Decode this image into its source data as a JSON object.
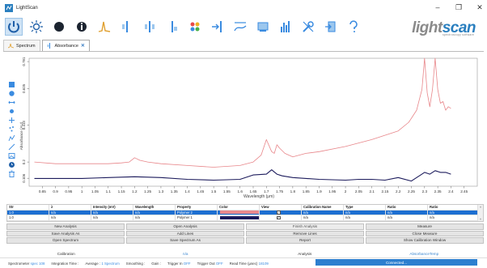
{
  "window": {
    "title": "LightScan"
  },
  "logo": {
    "part1": "light",
    "part2": "scan",
    "tagline": "spectroscopy software"
  },
  "tabs": [
    {
      "label": "Spectrum"
    },
    {
      "label": "Absorbance",
      "close": "✕"
    }
  ],
  "chart_data": {
    "type": "line",
    "xlabel": "Wavelength (μm)",
    "ylabel": "Absorbance (AU)",
    "xlim": [
      0.8,
      2.5
    ],
    "ylim": [
      0.06,
      0.8
    ],
    "x_ticks": [
      "0.85",
      "0.9",
      "0.95",
      "1",
      "1.05",
      "1.1",
      "1.15",
      "1.2",
      "1.25",
      "1.3",
      "1.35",
      "1.4",
      "1.45",
      "1.5",
      "1.55",
      "1.6",
      "1.65",
      "1.7",
      "1.75",
      "1.8",
      "1.85",
      "1.9",
      "1.95",
      "2",
      "2.05",
      "2.1",
      "2.15",
      "2.2",
      "2.25",
      "2.3",
      "2.35",
      "2.4",
      "2.45"
    ],
    "x_tick_values": [
      0.85,
      0.9,
      0.95,
      1,
      1.05,
      1.1,
      1.15,
      1.2,
      1.25,
      1.3,
      1.35,
      1.4,
      1.45,
      1.5,
      1.55,
      1.6,
      1.65,
      1.7,
      1.75,
      1.8,
      1.85,
      1.9,
      1.95,
      2,
      2.05,
      2.1,
      2.15,
      2.2,
      2.25,
      2.3,
      2.35,
      2.4,
      2.45
    ],
    "y_ticks": [
      "0.106",
      "0.2",
      "0.413",
      "0.625",
      "0.781"
    ],
    "y_tick_values": [
      0.106,
      0.2,
      0.413,
      0.625,
      0.781
    ],
    "series": [
      {
        "name": "Polymer 2",
        "color": "#e8868a",
        "x": [
          0.82,
          0.9,
          1.0,
          1.1,
          1.15,
          1.18,
          1.2,
          1.22,
          1.25,
          1.3,
          1.4,
          1.5,
          1.6,
          1.65,
          1.68,
          1.7,
          1.72,
          1.73,
          1.74,
          1.75,
          1.77,
          1.8,
          1.85,
          1.9,
          2.0,
          2.1,
          2.2,
          2.24,
          2.27,
          2.29,
          2.3,
          2.31,
          2.32,
          2.33,
          2.34,
          2.35,
          2.36,
          2.37,
          2.38,
          2.39,
          2.4
        ],
        "y": [
          0.2,
          0.19,
          0.19,
          0.19,
          0.195,
          0.2,
          0.225,
          0.21,
          0.2,
          0.19,
          0.18,
          0.17,
          0.18,
          0.2,
          0.24,
          0.33,
          0.26,
          0.25,
          0.3,
          0.28,
          0.25,
          0.23,
          0.25,
          0.26,
          0.29,
          0.33,
          0.38,
          0.43,
          0.5,
          0.62,
          0.8,
          0.6,
          0.52,
          0.62,
          0.8,
          0.62,
          0.54,
          0.55,
          0.5,
          0.52,
          0.51
        ]
      },
      {
        "name": "Polymer 1",
        "color": "#1c1b5c",
        "x": [
          0.82,
          0.9,
          1.0,
          1.1,
          1.2,
          1.3,
          1.4,
          1.5,
          1.6,
          1.65,
          1.7,
          1.72,
          1.74,
          1.76,
          1.8,
          1.9,
          2.0,
          2.05,
          2.1,
          2.15,
          2.2,
          2.25,
          2.28,
          2.3,
          2.32,
          2.34,
          2.36,
          2.38,
          2.4
        ],
        "y": [
          0.105,
          0.105,
          0.105,
          0.11,
          0.115,
          0.11,
          0.1,
          0.095,
          0.1,
          0.125,
          0.13,
          0.155,
          0.13,
          0.12,
          0.11,
          0.1,
          0.095,
          0.1,
          0.1,
          0.095,
          0.11,
          0.09,
          0.12,
          0.14,
          0.13,
          0.15,
          0.14,
          0.14,
          0.13
        ]
      }
    ]
  },
  "table": {
    "headers": [
      "Str",
      "λ",
      "Intensity (mV)",
      "Wavelength",
      "Property",
      "Color",
      "View",
      "Calibration Name",
      "Type",
      "Ratio",
      "Ratio"
    ],
    "rows": [
      {
        "str": "1.0",
        "lambda": "n/a",
        "intensity": "n/a",
        "wavelength": "n/a",
        "property": "Polymer 2",
        "color": "#e8888c",
        "view": "✓",
        "cal": "n/a",
        "type": "n/a",
        "ratio": "n/a",
        "ratio2": "n/a"
      },
      {
        "str": "1.0",
        "lambda": "n/a",
        "intensity": "n/a",
        "wavelength": "n/a",
        "property": "Polymer 1",
        "color": "#1c1b5c",
        "view": "✓",
        "cal": "n/a",
        "type": "n/a",
        "ratio": "n/a",
        "ratio2": "n/a"
      }
    ]
  },
  "buttons": {
    "new_analysis": "New Analysis",
    "open_analysis": "Open Analysis",
    "finish_analysis": "Finish Analysis",
    "measure": "Measure",
    "save_analysis_as": "Save Analysis As",
    "add_lines": "Add Lines",
    "remove_lines": "Remove Lines",
    "close_measure": "Close Measure",
    "open_spectrum": "Open Spectrum",
    "save_spectrum_as": "Save Spectrum As",
    "report": "Report",
    "show_calibration_window": "Show Calibration Window"
  },
  "sections": {
    "calibration": "Calibration",
    "calibration_value": "n/a",
    "analysis": "Analysis",
    "absorbance_temp": "AbsorbanceTemp"
  },
  "status": {
    "spectrometer_label": "Spectrometer",
    "spectrometer_value": "spec 108",
    "integration_label": "Integration Time :",
    "integration_value": "",
    "average_label": "Average :",
    "average_value": "1 Spectrum",
    "smoothing_label": "Smoothing :",
    "smoothing_value": "",
    "gain_label": "Gain :",
    "gain_value": "",
    "trigger_in_label": "Trigger In",
    "trigger_in_value": "OFF",
    "trigger_out_label": "Trigger Out",
    "trigger_out_value": "OFF",
    "read_time_label": "Read Time (µsec)",
    "read_time_value": "18109",
    "connected": "Connected..."
  }
}
